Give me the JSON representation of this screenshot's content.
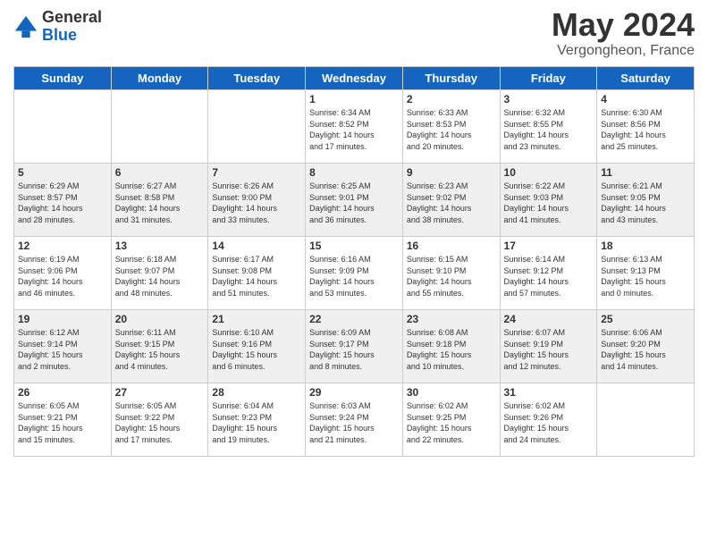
{
  "logo": {
    "general": "General",
    "blue": "Blue"
  },
  "header": {
    "month": "May 2024",
    "location": "Vergongheon, France"
  },
  "weekdays": [
    "Sunday",
    "Monday",
    "Tuesday",
    "Wednesday",
    "Thursday",
    "Friday",
    "Saturday"
  ],
  "rows": [
    {
      "cells": [
        {
          "day": "",
          "info": ""
        },
        {
          "day": "",
          "info": ""
        },
        {
          "day": "",
          "info": ""
        },
        {
          "day": "1",
          "info": "Sunrise: 6:34 AM\nSunset: 8:52 PM\nDaylight: 14 hours\nand 17 minutes."
        },
        {
          "day": "2",
          "info": "Sunrise: 6:33 AM\nSunset: 8:53 PM\nDaylight: 14 hours\nand 20 minutes."
        },
        {
          "day": "3",
          "info": "Sunrise: 6:32 AM\nSunset: 8:55 PM\nDaylight: 14 hours\nand 23 minutes."
        },
        {
          "day": "4",
          "info": "Sunrise: 6:30 AM\nSunset: 8:56 PM\nDaylight: 14 hours\nand 25 minutes."
        }
      ],
      "alt": false
    },
    {
      "cells": [
        {
          "day": "5",
          "info": "Sunrise: 6:29 AM\nSunset: 8:57 PM\nDaylight: 14 hours\nand 28 minutes."
        },
        {
          "day": "6",
          "info": "Sunrise: 6:27 AM\nSunset: 8:58 PM\nDaylight: 14 hours\nand 31 minutes."
        },
        {
          "day": "7",
          "info": "Sunrise: 6:26 AM\nSunset: 9:00 PM\nDaylight: 14 hours\nand 33 minutes."
        },
        {
          "day": "8",
          "info": "Sunrise: 6:25 AM\nSunset: 9:01 PM\nDaylight: 14 hours\nand 36 minutes."
        },
        {
          "day": "9",
          "info": "Sunrise: 6:23 AM\nSunset: 9:02 PM\nDaylight: 14 hours\nand 38 minutes."
        },
        {
          "day": "10",
          "info": "Sunrise: 6:22 AM\nSunset: 9:03 PM\nDaylight: 14 hours\nand 41 minutes."
        },
        {
          "day": "11",
          "info": "Sunrise: 6:21 AM\nSunset: 9:05 PM\nDaylight: 14 hours\nand 43 minutes."
        }
      ],
      "alt": true
    },
    {
      "cells": [
        {
          "day": "12",
          "info": "Sunrise: 6:19 AM\nSunset: 9:06 PM\nDaylight: 14 hours\nand 46 minutes."
        },
        {
          "day": "13",
          "info": "Sunrise: 6:18 AM\nSunset: 9:07 PM\nDaylight: 14 hours\nand 48 minutes."
        },
        {
          "day": "14",
          "info": "Sunrise: 6:17 AM\nSunset: 9:08 PM\nDaylight: 14 hours\nand 51 minutes."
        },
        {
          "day": "15",
          "info": "Sunrise: 6:16 AM\nSunset: 9:09 PM\nDaylight: 14 hours\nand 53 minutes."
        },
        {
          "day": "16",
          "info": "Sunrise: 6:15 AM\nSunset: 9:10 PM\nDaylight: 14 hours\nand 55 minutes."
        },
        {
          "day": "17",
          "info": "Sunrise: 6:14 AM\nSunset: 9:12 PM\nDaylight: 14 hours\nand 57 minutes."
        },
        {
          "day": "18",
          "info": "Sunrise: 6:13 AM\nSunset: 9:13 PM\nDaylight: 15 hours\nand 0 minutes."
        }
      ],
      "alt": false
    },
    {
      "cells": [
        {
          "day": "19",
          "info": "Sunrise: 6:12 AM\nSunset: 9:14 PM\nDaylight: 15 hours\nand 2 minutes."
        },
        {
          "day": "20",
          "info": "Sunrise: 6:11 AM\nSunset: 9:15 PM\nDaylight: 15 hours\nand 4 minutes."
        },
        {
          "day": "21",
          "info": "Sunrise: 6:10 AM\nSunset: 9:16 PM\nDaylight: 15 hours\nand 6 minutes."
        },
        {
          "day": "22",
          "info": "Sunrise: 6:09 AM\nSunset: 9:17 PM\nDaylight: 15 hours\nand 8 minutes."
        },
        {
          "day": "23",
          "info": "Sunrise: 6:08 AM\nSunset: 9:18 PM\nDaylight: 15 hours\nand 10 minutes."
        },
        {
          "day": "24",
          "info": "Sunrise: 6:07 AM\nSunset: 9:19 PM\nDaylight: 15 hours\nand 12 minutes."
        },
        {
          "day": "25",
          "info": "Sunrise: 6:06 AM\nSunset: 9:20 PM\nDaylight: 15 hours\nand 14 minutes."
        }
      ],
      "alt": true
    },
    {
      "cells": [
        {
          "day": "26",
          "info": "Sunrise: 6:05 AM\nSunset: 9:21 PM\nDaylight: 15 hours\nand 15 minutes."
        },
        {
          "day": "27",
          "info": "Sunrise: 6:05 AM\nSunset: 9:22 PM\nDaylight: 15 hours\nand 17 minutes."
        },
        {
          "day": "28",
          "info": "Sunrise: 6:04 AM\nSunset: 9:23 PM\nDaylight: 15 hours\nand 19 minutes."
        },
        {
          "day": "29",
          "info": "Sunrise: 6:03 AM\nSunset: 9:24 PM\nDaylight: 15 hours\nand 21 minutes."
        },
        {
          "day": "30",
          "info": "Sunrise: 6:02 AM\nSunset: 9:25 PM\nDaylight: 15 hours\nand 22 minutes."
        },
        {
          "day": "31",
          "info": "Sunrise: 6:02 AM\nSunset: 9:26 PM\nDaylight: 15 hours\nand 24 minutes."
        },
        {
          "day": "",
          "info": ""
        }
      ],
      "alt": false
    }
  ]
}
